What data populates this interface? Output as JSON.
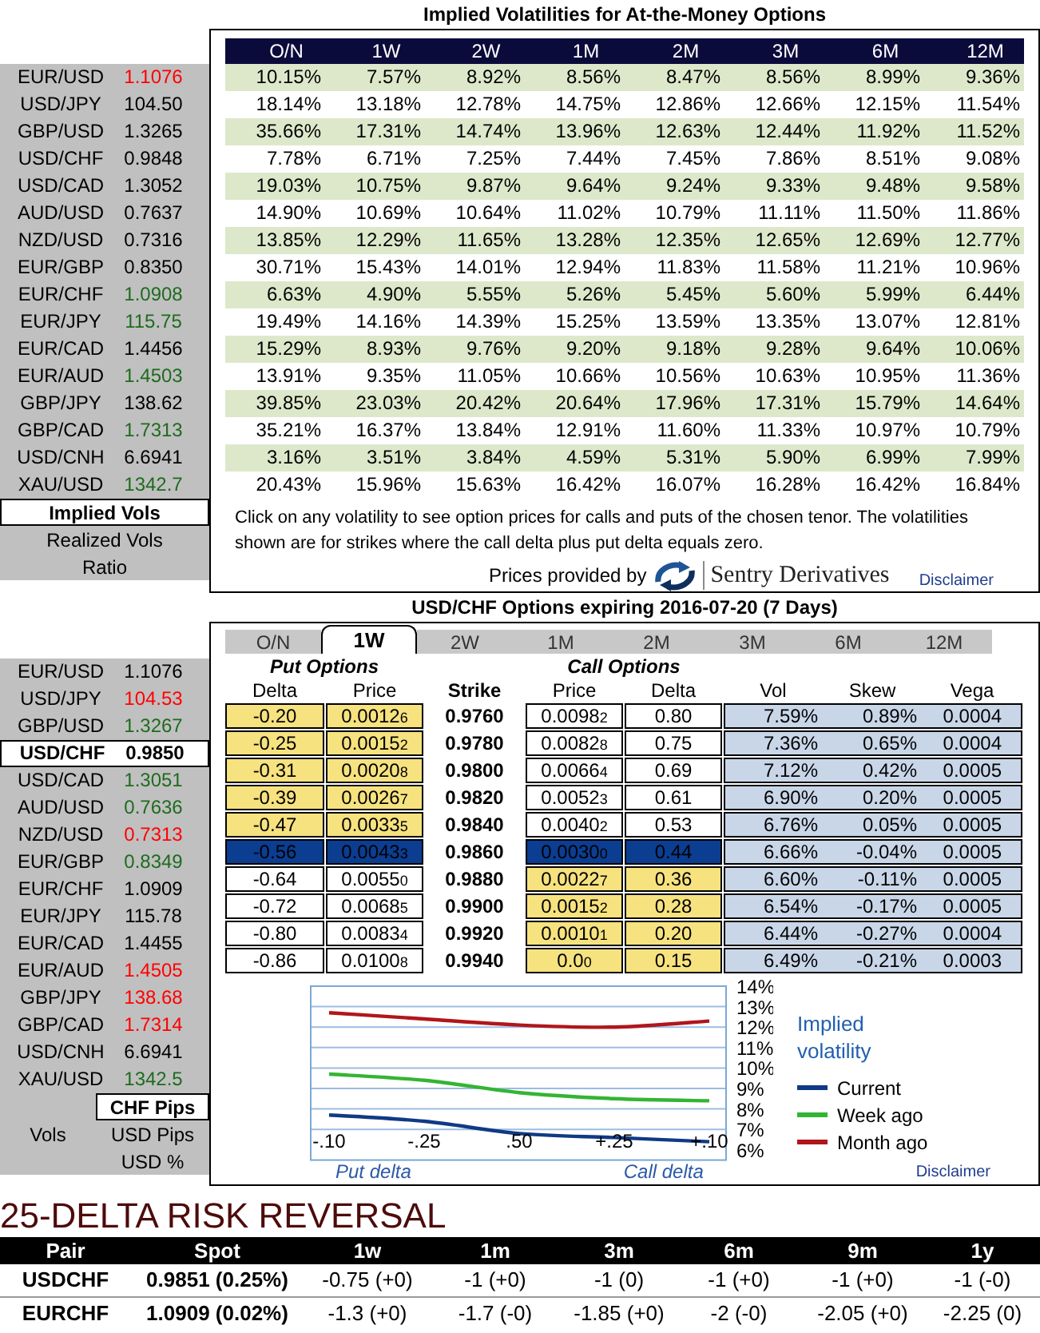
{
  "volatility_panel": {
    "title": "Implied Volatilities for At-the-Money Options",
    "pairs": [
      {
        "pair": "EUR/USD",
        "rate": "1.1076",
        "color": "#ff0000"
      },
      {
        "pair": "USD/JPY",
        "rate": "104.50",
        "color": "#000000"
      },
      {
        "pair": "GBP/USD",
        "rate": "1.3265",
        "color": "#000000"
      },
      {
        "pair": "USD/CHF",
        "rate": "0.9848",
        "color": "#000000"
      },
      {
        "pair": "USD/CAD",
        "rate": "1.3052",
        "color": "#000000"
      },
      {
        "pair": "AUD/USD",
        "rate": "0.7637",
        "color": "#000000"
      },
      {
        "pair": "NZD/USD",
        "rate": "0.7316",
        "color": "#000000"
      },
      {
        "pair": "EUR/GBP",
        "rate": "0.8350",
        "color": "#000000"
      },
      {
        "pair": "EUR/CHF",
        "rate": "1.0908",
        "color": "#1e6b1e"
      },
      {
        "pair": "EUR/JPY",
        "rate": "115.75",
        "color": "#1e6b1e"
      },
      {
        "pair": "EUR/CAD",
        "rate": "1.4456",
        "color": "#000000"
      },
      {
        "pair": "EUR/AUD",
        "rate": "1.4503",
        "color": "#1e6b1e"
      },
      {
        "pair": "GBP/JPY",
        "rate": "138.62",
        "color": "#000000"
      },
      {
        "pair": "GBP/CAD",
        "rate": "1.7313",
        "color": "#1e6b1e"
      },
      {
        "pair": "USD/CNH",
        "rate": "6.6941",
        "color": "#000000"
      },
      {
        "pair": "XAU/USD",
        "rate": "1342.7",
        "color": "#1e6b1e"
      }
    ],
    "view_options": [
      {
        "label": "Implied Vols",
        "selected": true
      },
      {
        "label": "Realized Vols",
        "selected": false
      },
      {
        "label": "Ratio",
        "selected": false
      }
    ],
    "table": {
      "columns": [
        "O/N",
        "1W",
        "2W",
        "1M",
        "2M",
        "3M",
        "6M",
        "12M"
      ],
      "rows": [
        [
          "10.15%",
          "7.57%",
          "8.92%",
          "8.56%",
          "8.47%",
          "8.56%",
          "8.99%",
          "9.36%"
        ],
        [
          "18.14%",
          "13.18%",
          "12.78%",
          "14.75%",
          "12.86%",
          "12.66%",
          "12.15%",
          "11.54%"
        ],
        [
          "35.66%",
          "17.31%",
          "14.74%",
          "13.96%",
          "12.63%",
          "12.44%",
          "11.92%",
          "11.52%"
        ],
        [
          "7.78%",
          "6.71%",
          "7.25%",
          "7.44%",
          "7.45%",
          "7.86%",
          "8.51%",
          "9.08%"
        ],
        [
          "19.03%",
          "10.75%",
          "9.87%",
          "9.64%",
          "9.24%",
          "9.33%",
          "9.48%",
          "9.58%"
        ],
        [
          "14.90%",
          "10.69%",
          "10.64%",
          "11.02%",
          "10.79%",
          "11.11%",
          "11.50%",
          "11.86%"
        ],
        [
          "13.85%",
          "12.29%",
          "11.65%",
          "13.28%",
          "12.35%",
          "12.65%",
          "12.69%",
          "12.77%"
        ],
        [
          "30.71%",
          "15.43%",
          "14.01%",
          "12.94%",
          "11.83%",
          "11.58%",
          "11.21%",
          "10.96%"
        ],
        [
          "6.63%",
          "4.90%",
          "5.55%",
          "5.26%",
          "5.45%",
          "5.60%",
          "5.99%",
          "6.44%"
        ],
        [
          "19.49%",
          "14.16%",
          "14.39%",
          "15.25%",
          "13.59%",
          "13.35%",
          "13.07%",
          "12.81%"
        ],
        [
          "15.29%",
          "8.93%",
          "9.76%",
          "9.20%",
          "9.18%",
          "9.28%",
          "9.64%",
          "10.06%"
        ],
        [
          "13.91%",
          "9.35%",
          "11.05%",
          "10.66%",
          "10.56%",
          "10.63%",
          "10.95%",
          "11.36%"
        ],
        [
          "39.85%",
          "23.03%",
          "20.42%",
          "20.64%",
          "17.96%",
          "17.31%",
          "15.79%",
          "14.64%"
        ],
        [
          "35.21%",
          "16.37%",
          "13.84%",
          "12.91%",
          "11.60%",
          "11.33%",
          "10.97%",
          "10.79%"
        ],
        [
          "3.16%",
          "3.51%",
          "3.84%",
          "4.59%",
          "5.31%",
          "5.90%",
          "6.99%",
          "7.99%"
        ],
        [
          "20.43%",
          "15.96%",
          "15.63%",
          "16.42%",
          "16.07%",
          "16.28%",
          "16.42%",
          "16.84%"
        ]
      ]
    },
    "note": "Click on any volatility to see option prices for calls and puts of the chosen tenor. The volatilities shown are for strikes where the call delta plus put delta equals zero.",
    "credit": {
      "text": "Prices provided by",
      "provider": "Sentry Derivatives"
    },
    "disclaimer": "Disclaimer"
  },
  "options_panel": {
    "title": "USD/CHF Options expiring 2016-07-20 (7 Days)",
    "tabs": [
      {
        "label": "O/N",
        "selected": false
      },
      {
        "label": "1W",
        "selected": true
      },
      {
        "label": "2W",
        "selected": false
      },
      {
        "label": "1M",
        "selected": false
      },
      {
        "label": "2M",
        "selected": false
      },
      {
        "label": "3M",
        "selected": false
      },
      {
        "label": "6M",
        "selected": false
      },
      {
        "label": "12M",
        "selected": false
      }
    ],
    "pairs": [
      {
        "pair": "EUR/USD",
        "rate": "1.1076",
        "color": "#000000",
        "selected": false
      },
      {
        "pair": "USD/JPY",
        "rate": "104.53",
        "color": "#ff0000",
        "selected": false
      },
      {
        "pair": "GBP/USD",
        "rate": "1.3267",
        "color": "#1e6b1e",
        "selected": false
      },
      {
        "pair": "USD/CHF",
        "rate": "0.9850",
        "color": "#000000",
        "selected": true
      },
      {
        "pair": "USD/CAD",
        "rate": "1.3051",
        "color": "#1e6b1e",
        "selected": false
      },
      {
        "pair": "AUD/USD",
        "rate": "0.7636",
        "color": "#1e6b1e",
        "selected": false
      },
      {
        "pair": "NZD/USD",
        "rate": "0.7313",
        "color": "#ff0000",
        "selected": false
      },
      {
        "pair": "EUR/GBP",
        "rate": "0.8349",
        "color": "#1e6b1e",
        "selected": false
      },
      {
        "pair": "EUR/CHF",
        "rate": "1.0909",
        "color": "#000000",
        "selected": false
      },
      {
        "pair": "EUR/JPY",
        "rate": "115.78",
        "color": "#000000",
        "selected": false
      },
      {
        "pair": "EUR/CAD",
        "rate": "1.4455",
        "color": "#000000",
        "selected": false
      },
      {
        "pair": "EUR/AUD",
        "rate": "1.4505",
        "color": "#ff0000",
        "selected": false
      },
      {
        "pair": "GBP/JPY",
        "rate": "138.68",
        "color": "#ff0000",
        "selected": false
      },
      {
        "pair": "GBP/CAD",
        "rate": "1.7314",
        "color": "#ff0000",
        "selected": false
      },
      {
        "pair": "USD/CNH",
        "rate": "6.6941",
        "color": "#000000",
        "selected": false
      },
      {
        "pair": "XAU/USD",
        "rate": "1342.5",
        "color": "#1e6b1e",
        "selected": false
      }
    ],
    "units": {
      "label": "Vols",
      "options": [
        {
          "label": "CHF Pips",
          "selected": true
        },
        {
          "label": "USD Pips",
          "selected": false
        },
        {
          "label": "USD %",
          "selected": false
        }
      ]
    },
    "put_header": "Put Options",
    "call_header": "Call Options",
    "columns": [
      "Delta",
      "Price",
      "Strike",
      "Price",
      "Delta",
      "Vol",
      "Skew",
      "Vega"
    ],
    "rows": [
      {
        "put_delta": "-0.20",
        "put_price": "0.0012$_{6}$",
        "strike": "0.9760",
        "call_price": "0.0098$_{2}$",
        "call_delta": "0.80",
        "vol": "7.59%",
        "skew": "0.89%",
        "vega": "0.0004",
        "put_highlighted": true,
        "call_highlighted": false,
        "at_the_money": false
      },
      {
        "put_delta": "-0.25",
        "put_price": "0.0015$_{2}$",
        "strike": "0.9780",
        "call_price": "0.0082$_{8}$",
        "call_delta": "0.75",
        "vol": "7.36%",
        "skew": "0.65%",
        "vega": "0.0004",
        "put_highlighted": true,
        "call_highlighted": false,
        "at_the_money": false
      },
      {
        "put_delta": "-0.31",
        "put_price": "0.0020$_{8}$",
        "strike": "0.9800",
        "call_price": "0.0066$_{4}$",
        "call_delta": "0.69",
        "vol": "7.12%",
        "skew": "0.42%",
        "vega": "0.0005",
        "put_highlighted": true,
        "call_highlighted": false,
        "at_the_money": false
      },
      {
        "put_delta": "-0.39",
        "put_price": "0.0026$_{7}$",
        "strike": "0.9820",
        "call_price": "0.0052$_{3}$",
        "call_delta": "0.61",
        "vol": "6.90%",
        "skew": "0.20%",
        "vega": "0.0005",
        "put_highlighted": true,
        "call_highlighted": false,
        "at_the_money": false
      },
      {
        "put_delta": "-0.47",
        "put_price": "0.0033$_{5}$",
        "strike": "0.9840",
        "call_price": "0.0040$_{2}$",
        "call_delta": "0.53",
        "vol": "6.76%",
        "skew": "0.05%",
        "vega": "0.0005",
        "put_highlighted": true,
        "call_highlighted": false,
        "at_the_money": false
      },
      {
        "put_delta": "-0.56",
        "put_price": "0.0043$_{3}$",
        "strike": "0.9860",
        "call_price": "0.0030$_{0}$",
        "call_delta": "0.44",
        "vol": "6.66%",
        "skew": "-0.04%",
        "vega": "0.0005",
        "put_highlighted": false,
        "call_highlighted": false,
        "at_the_money": true
      },
      {
        "put_delta": "-0.64",
        "put_price": "0.0055$_{0}$",
        "strike": "0.9880",
        "call_price": "0.0022$_{7}$",
        "call_delta": "0.36",
        "vol": "6.60%",
        "skew": "-0.11%",
        "vega": "0.0005",
        "put_highlighted": false,
        "call_highlighted": true,
        "at_the_money": false
      },
      {
        "put_delta": "-0.72",
        "put_price": "0.0068$_{5}$",
        "strike": "0.9900",
        "call_price": "0.0015$_{2}$",
        "call_delta": "0.28",
        "vol": "6.54%",
        "skew": "-0.17%",
        "vega": "0.0005",
        "put_highlighted": false,
        "call_highlighted": true,
        "at_the_money": false
      },
      {
        "put_delta": "-0.80",
        "put_price": "0.0083$_{4}$",
        "strike": "0.9920",
        "call_price": "0.0010$_{1}$",
        "call_delta": "0.20",
        "vol": "6.44%",
        "skew": "-0.27%",
        "vega": "0.0004",
        "put_highlighted": false,
        "call_highlighted": true,
        "at_the_money": false
      },
      {
        "put_delta": "-0.86",
        "put_price": "0.0100$_{8}$",
        "strike": "0.9940",
        "call_price": "0.0$_{0}$",
        "call_delta": "0.15",
        "vol": "6.49%",
        "skew": "-0.21%",
        "vega": "0.0003",
        "put_highlighted": false,
        "call_highlighted": true,
        "at_the_money": false
      }
    ],
    "smile_chart": {
      "chart_data": {
        "type": "line",
        "categories": [
          "-.10",
          "-.25",
          ".50",
          "+.25",
          "+.10"
        ],
        "series": [
          {
            "name": "Current",
            "color": "#0f3a85",
            "values": [
              7.7,
              7.4,
              6.8,
              6.6,
              6.4
            ]
          },
          {
            "name": "Week ago",
            "color": "#33b533",
            "values": [
              9.7,
              9.4,
              8.8,
              8.5,
              8.4
            ]
          },
          {
            "name": "Month ago",
            "color": "#b0161b",
            "values": [
              12.7,
              12.4,
              12.1,
              12.0,
              12.3
            ]
          }
        ],
        "ylim": [
          5.5,
          14
        ],
        "yticks": [
          {
            "value": 6,
            "label": "6%"
          },
          {
            "value": 7,
            "label": "7%"
          },
          {
            "value": 8,
            "label": "8%"
          },
          {
            "value": 9,
            "label": "9%"
          },
          {
            "value": 10,
            "label": "10%"
          },
          {
            "value": 11,
            "label": "11%"
          },
          {
            "value": 12,
            "label": "12%"
          },
          {
            "value": 13,
            "label": "13%"
          },
          {
            "value": 14,
            "label": "14%"
          }
        ],
        "grid": true
      },
      "legend_title": "Implied volatility",
      "put_axis_label": "Put delta",
      "call_axis_label": "Call delta"
    },
    "disclaimer": "Disclaimer"
  },
  "risk_reversal": {
    "title": "25-DELTA RISK REVERSAL",
    "columns": [
      "Pair",
      "Spot",
      "1w",
      "1m",
      "3m",
      "6m",
      "9m",
      "1y"
    ],
    "rows": [
      [
        "USDCHF",
        "0.9851 (0.25%)",
        "-0.75 (+0)",
        "-1 (+0)",
        "-1 (0)",
        "-1 (+0)",
        "-1 (+0)",
        "-1 (-0)"
      ],
      [
        "EURCHF",
        "1.0909 (0.02%)",
        "-1.3 (+0)",
        "-1.7 (-0)",
        "-1.85 (+0)",
        "-2 (-0)",
        "-2.05 (+0)",
        "-2.25 (0)"
      ]
    ]
  }
}
